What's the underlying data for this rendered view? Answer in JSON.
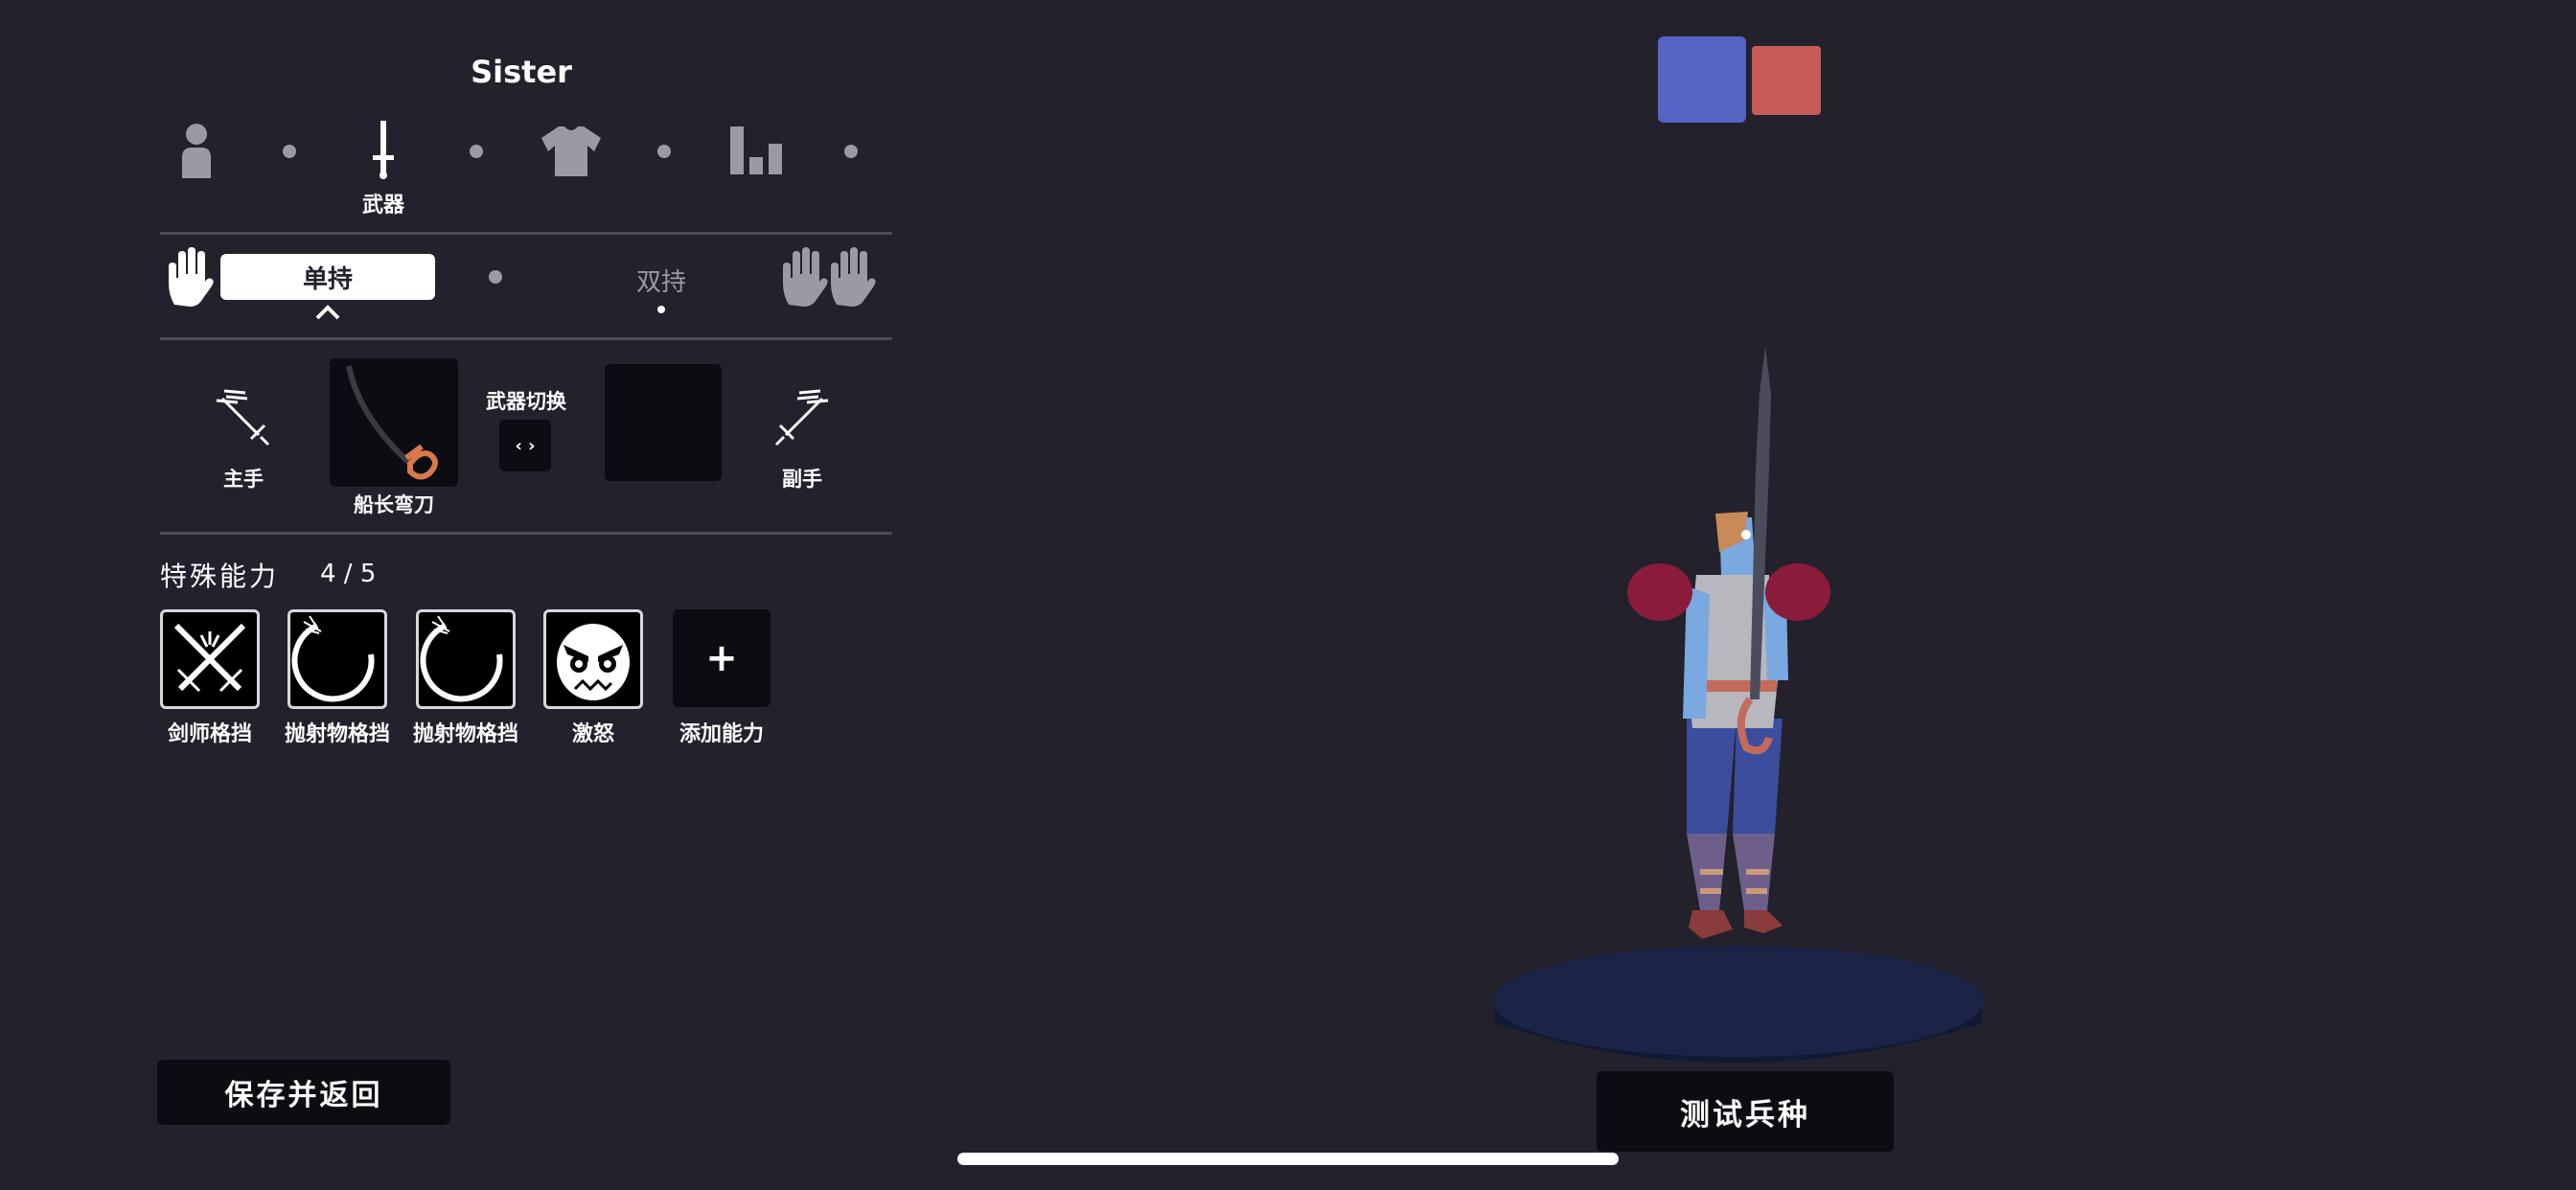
{
  "unit": {
    "name": "Sister"
  },
  "categories": {
    "weapon_label": "武器",
    "items": [
      "body-icon",
      "sword-icon",
      "shirt-icon",
      "stats-icon"
    ]
  },
  "grip": {
    "single": "单持",
    "dual": "双持"
  },
  "weapons": {
    "main_hand_label": "主手",
    "off_hand_label": "副手",
    "main_weapon_name": "船长弯刀",
    "switch_label": "武器切换",
    "switch_symbol": "‹ ›"
  },
  "abilities": {
    "title": "特殊能力",
    "count": "4 / 5",
    "items": [
      {
        "label": "剑师格挡",
        "icon": "crossed-swords-icon"
      },
      {
        "label": "抛射物格挡",
        "icon": "projectile-block-icon"
      },
      {
        "label": "抛射物格挡",
        "icon": "projectile-block-icon"
      },
      {
        "label": "激怒",
        "icon": "angry-face-icon"
      }
    ],
    "add_label": "添加能力",
    "add_symbol": "+"
  },
  "buttons": {
    "save": "保存并返回",
    "test": "测试兵种"
  },
  "team_colors": {
    "blue": "#5563c4",
    "red": "#c85a5a"
  },
  "colors": {
    "background": "#22212c",
    "slot": "#0c0c13",
    "muted": "#9b9aa4"
  }
}
